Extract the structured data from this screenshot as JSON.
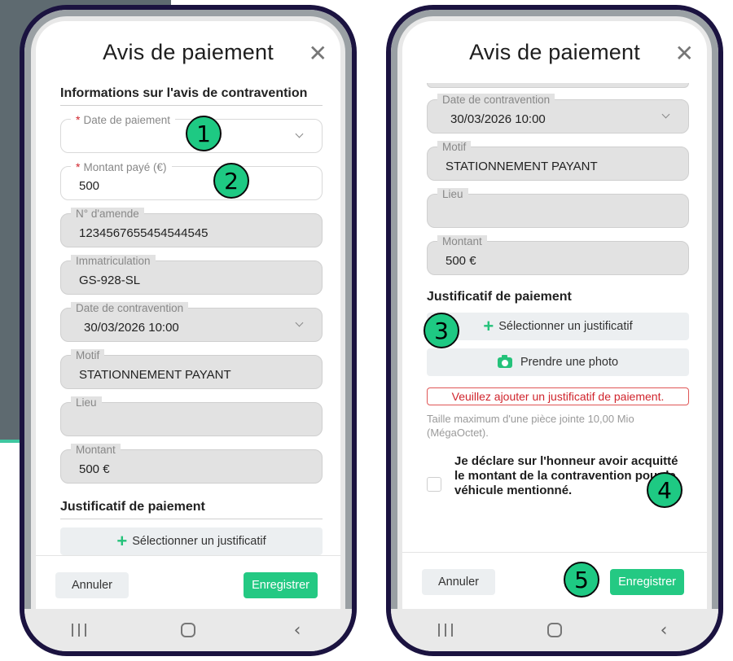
{
  "left": {
    "title": "Avis de paiement",
    "section_info": "Informations sur l'avis de contravention",
    "fields": [
      {
        "label": "Date de paiement",
        "value": "",
        "required": true
      },
      {
        "label": "Montant payé (€)",
        "value": "500",
        "required": true
      },
      {
        "label": "N° d'amende",
        "value": "1234567655454544545"
      },
      {
        "label": "Immatriculation",
        "value": "GS-928-SL"
      },
      {
        "label": "Date de contravention",
        "value": "30/03/2026 10:00"
      },
      {
        "label": "Motif",
        "value": "STATIONNEMENT PAYANT"
      },
      {
        "label": "Lieu",
        "value": ""
      },
      {
        "label": "Montant",
        "value": "500 €"
      }
    ],
    "section_proof": "Justificatif de paiement",
    "upload_label": "Sélectionner un justificatif",
    "cancel": "Annuler",
    "save": "Enregistrer"
  },
  "right": {
    "title": "Avis de paiement",
    "fields": [
      {
        "label": "Date de contravention",
        "value": "30/03/2026 10:00"
      },
      {
        "label": "Motif",
        "value": "STATIONNEMENT PAYANT"
      },
      {
        "label": "Lieu",
        "value": ""
      },
      {
        "label": "Montant",
        "value": "500 €"
      }
    ],
    "section_proof": "Justificatif de paiement",
    "upload_label": "Sélectionner un justificatif",
    "photo_label": "Prendre une photo",
    "error": "Veuillez ajouter un justificatif de paiement.",
    "hint": "Taille maximum d'une pièce jointe 10,00 Mio (MégaOctet).",
    "declaration": "Je déclare sur l'honneur avoir acquitté le montant de la contravention pour le véhicule mentionné.",
    "cancel": "Annuler",
    "save": "Enregistrer"
  },
  "badges": [
    "1",
    "2",
    "3",
    "4",
    "5"
  ],
  "icons": {
    "close": "close-icon",
    "chevron": "chevron-down-icon",
    "plus": "plus-icon",
    "camera": "camera-icon"
  },
  "colors": {
    "accent": "#24c983",
    "error": "#d0242c",
    "frame": "#1b1340"
  }
}
